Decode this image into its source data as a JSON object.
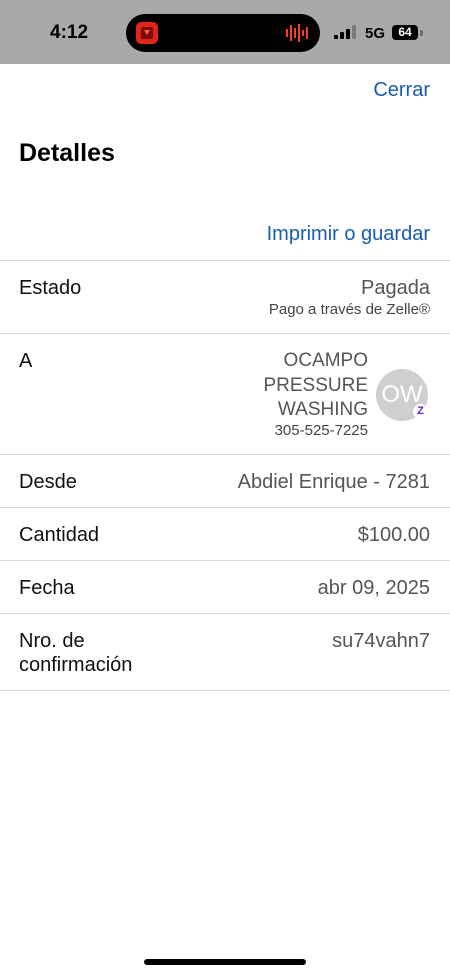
{
  "status_bar": {
    "time": "4:12",
    "network": "5G",
    "battery": "64",
    "icons": [
      "recording-app-icon",
      "audio-wave-icon",
      "signal-icon"
    ]
  },
  "header": {
    "close_label": "Cerrar",
    "title": "Detalles",
    "print_label": "Imprimir o guardar"
  },
  "details": {
    "status": {
      "label": "Estado",
      "value": "Pagada",
      "sub": "Pago a través de Zelle®"
    },
    "to": {
      "label": "A",
      "name": "OCAMPO\nPRESSURE\nWASHING",
      "phone": "305-525-7225",
      "avatar_initials": "OW",
      "badge": "Z"
    },
    "from": {
      "label": "Desde",
      "value": "Abdiel Enrique - 7281"
    },
    "amount": {
      "label": "Cantidad",
      "value": "$100.00"
    },
    "date": {
      "label": "Fecha",
      "value": "abr 09, 2025"
    },
    "confirmation": {
      "label": "Nro. de\nconfirmación",
      "value": "su74vahn7"
    }
  },
  "colors": {
    "link": "#1a5cb2",
    "status_bar_bg": "#a9a9a9",
    "zelle_purple": "#6d1ed4",
    "recording_red": "#e0261a"
  }
}
